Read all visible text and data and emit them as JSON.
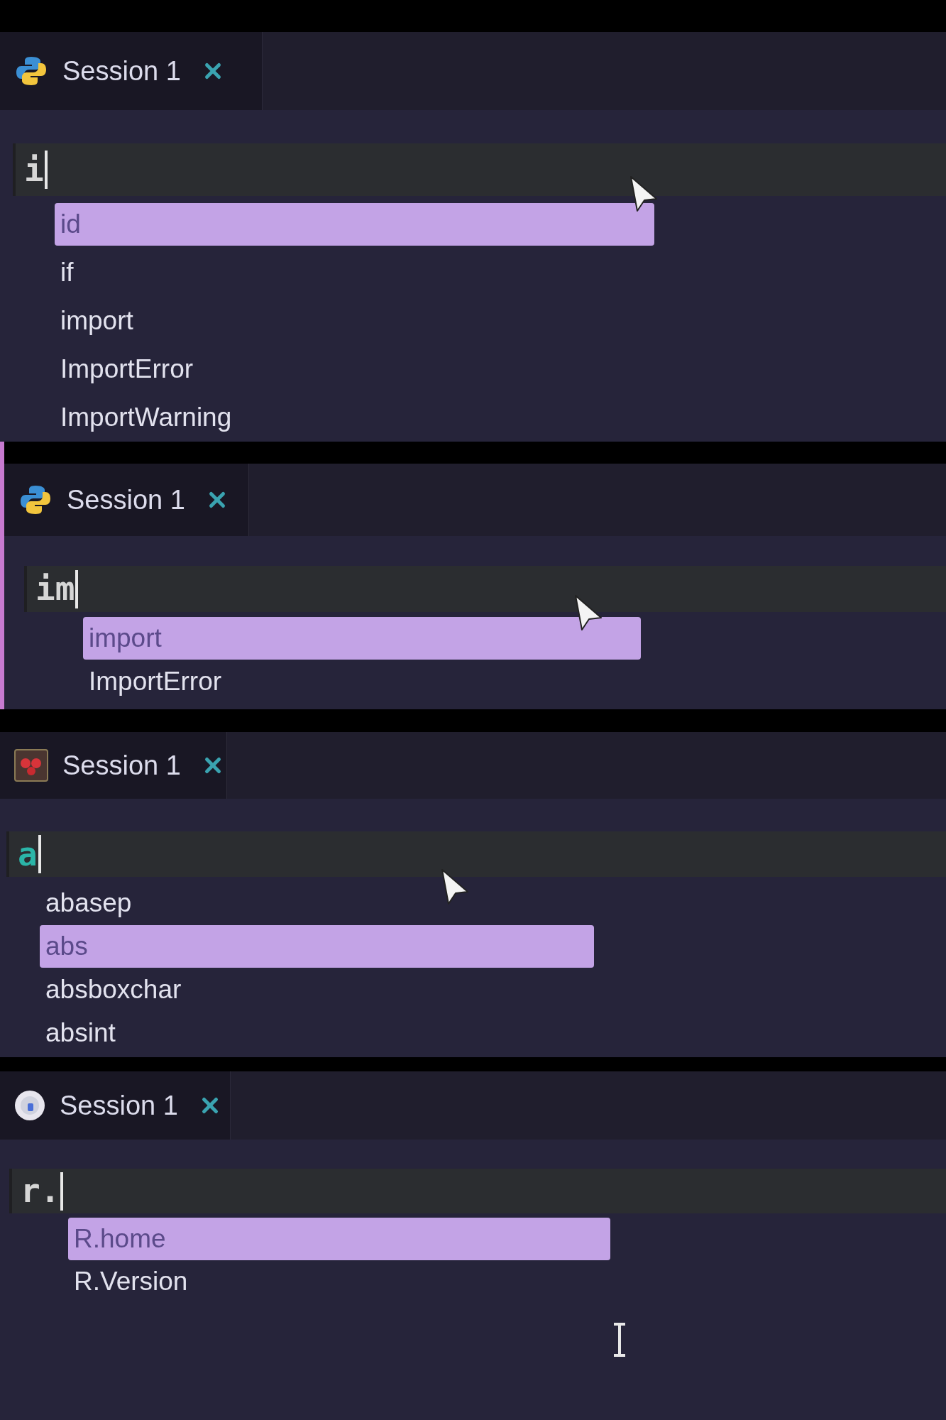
{
  "panels": [
    {
      "session": {
        "kind": "python",
        "label": "Session 1"
      },
      "input": {
        "value": "i",
        "color": "#d6d6d6"
      },
      "suggestions": [
        {
          "label": "id",
          "selected": true
        },
        {
          "label": "if",
          "selected": false
        },
        {
          "label": "import",
          "selected": false
        },
        {
          "label": "ImportError",
          "selected": false
        },
        {
          "label": "ImportWarning",
          "selected": false
        }
      ],
      "pointer": {
        "kind": "arrow"
      }
    },
    {
      "session": {
        "kind": "python",
        "label": "Session 1"
      },
      "input": {
        "value": "im",
        "color": "#d6d6d6"
      },
      "suggestions": [
        {
          "label": "import",
          "selected": true
        },
        {
          "label": "ImportError",
          "selected": false
        }
      ],
      "pointer": {
        "kind": "arrow"
      }
    },
    {
      "session": {
        "kind": "julia",
        "label": "Session 1"
      },
      "input": {
        "value": "a",
        "color": "#2bb5a8"
      },
      "suggestions": [
        {
          "label": "abasep",
          "selected": false
        },
        {
          "label": "abs",
          "selected": true
        },
        {
          "label": "absboxchar",
          "selected": false
        },
        {
          "label": "absint",
          "selected": false
        }
      ],
      "pointer": {
        "kind": "arrow"
      }
    },
    {
      "session": {
        "kind": "r",
        "label": "Session 1"
      },
      "input": {
        "value": "r.",
        "color": "#d6d6d6"
      },
      "suggestions": [
        {
          "label": "R.home",
          "selected": true
        },
        {
          "label": "R.Version",
          "selected": false
        }
      ],
      "pointer": {
        "kind": "ibeam"
      }
    }
  ]
}
